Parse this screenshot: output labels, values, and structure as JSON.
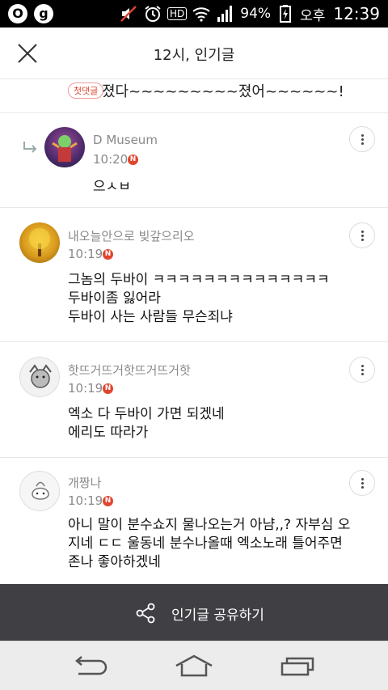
{
  "status_bar": {
    "app_icons": [
      "O",
      "g"
    ],
    "battery": "94%",
    "ampm": "오후",
    "time": "12:39",
    "hd_label": "HD"
  },
  "header": {
    "title": "12시, 인기글"
  },
  "first_comment": {
    "badge": "첫댓글",
    "text": "졌다~~~~~~~~~졌어~~~~~~!"
  },
  "comments": [
    {
      "author": "D Museum",
      "time": "10:20",
      "new": "N",
      "text": "으ㅅㅂ",
      "is_reply": true
    },
    {
      "author": "내오늘안으로 빚갚으리오",
      "time": "10:19",
      "new": "N",
      "text": "그놈의 두바이 ㅋㅋㅋㅋㅋㅋㅋㅋㅋㅋㅋㅋㅋㅋ\n두바이좀 잃어라\n두바이 사는 사람들 무슨죄냐"
    },
    {
      "author": "핫뜨거뜨거핫뜨거뜨거핫",
      "time": "10:19",
      "new": "N",
      "text": "엑소 다 두바이 가면 되겠네\n에리도 따라가"
    },
    {
      "author": "개짱나",
      "time": "10:19",
      "new": "N",
      "text": "아니 말이 분수쇼지 물나오는거 아냠,,? 자부심 오\n지네 ㄷㄷ 울동네 분수나올때 엑소노래 틀어주면\n존나 좋아하겠네"
    }
  ],
  "share_bar": {
    "label": "인기글 공유하기"
  },
  "colors": {
    "accent_red": "#e0452f",
    "share_bar_bg": "#3f3f44",
    "meta_gray": "#8a8a8a"
  }
}
